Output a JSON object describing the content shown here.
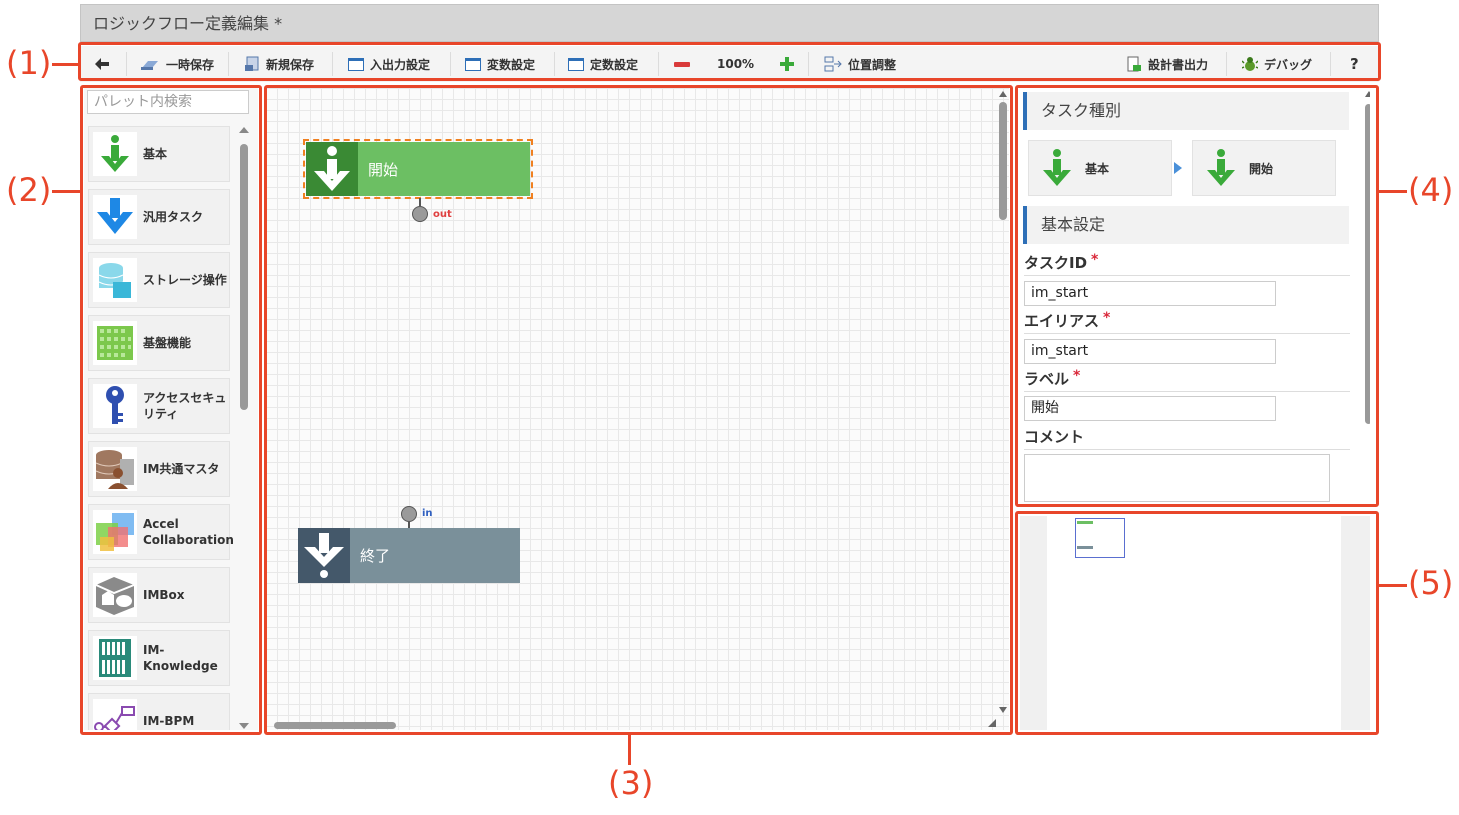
{
  "window": {
    "title": "ロジックフロー定義編集  *"
  },
  "toolbar": {
    "back_label": "",
    "temp_save": "一時保存",
    "new_save": "新規保存",
    "io_settings": "入出力設定",
    "var_settings": "変数設定",
    "const_settings": "定数設定",
    "zoom": "100%",
    "position_adjust": "位置調整",
    "export_spec": "設計書出力",
    "debug": "デバッグ",
    "help": "?"
  },
  "palette": {
    "search_placeholder": "パレット内検索",
    "items": [
      {
        "label": "基本",
        "icon": "green-down-arrow-icon"
      },
      {
        "label": "汎用タスク",
        "icon": "blue-down-arrow-icon"
      },
      {
        "label": "ストレージ操作",
        "icon": "storage-icon"
      },
      {
        "label": "基盤機能",
        "icon": "grid-blocks-icon"
      },
      {
        "label": "アクセスセキュリティ",
        "icon": "key-icon"
      },
      {
        "label": "IM共通マスタ",
        "icon": "database-user-icon"
      },
      {
        "label": "Accel Collaboration",
        "icon": "colored-squares-icon"
      },
      {
        "label": "IMBox",
        "icon": "imbox-icon"
      },
      {
        "label": "IM-Knowledge",
        "icon": "bookshelf-icon"
      },
      {
        "label": "IM-BPM",
        "icon": "bpm-flow-icon"
      }
    ]
  },
  "canvas": {
    "start_node": {
      "label": "開始",
      "port": "out"
    },
    "end_node": {
      "label": "終了",
      "port": "in"
    }
  },
  "properties": {
    "task_type_header": "タスク種別",
    "task_type_path": [
      "基本",
      "開始"
    ],
    "basic_settings_header": "基本設定",
    "fields": [
      {
        "label": "タスクID",
        "required_mark": "*",
        "value": "im_start"
      },
      {
        "label": "エイリアス",
        "required_mark": "*",
        "value": "im_start"
      },
      {
        "label": "ラベル",
        "required_mark": "*",
        "value": "開始"
      }
    ],
    "comment_label": "コメント",
    "comment_value": ""
  },
  "annotations": {
    "labels": [
      "(1)",
      "(2)",
      "(3)",
      "(4)",
      "(5)"
    ]
  },
  "colors": {
    "start_node": "#6cbf63",
    "end_node": "#7a909a",
    "annotation": "#e8462a",
    "accent": "#2e6fb7"
  }
}
